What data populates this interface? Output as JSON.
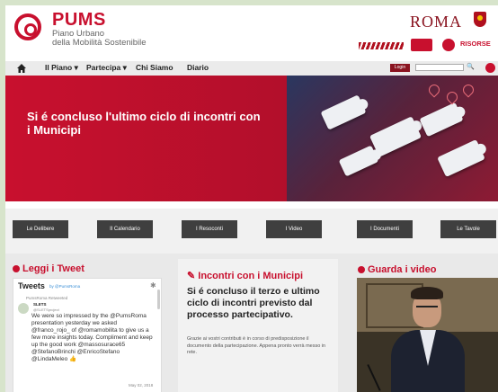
{
  "header": {
    "logo_title": "PUMS",
    "logo_line1": "Piano Urbano",
    "logo_line2": "della Mobilità Sostenibile",
    "city": "ROMA",
    "partner_text": "RISORSE"
  },
  "nav": {
    "items": [
      "Il Piano ▾",
      "Partecipa ▾",
      "Chi Siamo",
      "Diario"
    ],
    "login_label": "Login",
    "search_placeholder": ""
  },
  "hero": {
    "title": "Si é concluso l'ultimo ciclo di incontri con i Municipi"
  },
  "tiles": [
    "Le Delibere",
    "Il Calendario",
    "I Resoconti",
    "I Video",
    "I Documenti",
    "Le Tavole"
  ],
  "tweets": {
    "section_title": "Leggi i Tweet",
    "widget_title": "Tweets",
    "widget_handle": "by @PumsRoma",
    "retweet_label": "PumsRoma Retweeted",
    "author_name": "SLETS",
    "author_handle": "@SLETSproject",
    "text": "We were so impressed by the @PumsRoma presentation yesterday we asked @franco_rojo_ of @romamobilita to give us a few more insights today. Compliment and keep up the good work @massosurace65 @StefanoBrinchi @EnricoStefano @LindaMeleo 👍",
    "date": "May 02, 2018"
  },
  "municipi": {
    "title": "Incontri con i Municipi",
    "headline": "Si é concluso il terzo e ultimo ciclo di incontri previsto dal processo partecipativo.",
    "body": "Grazie ai vostri contributi è in corso di predisposizione il documento della partecipazione. Appena pronto verrà messo in rete."
  },
  "video": {
    "title": "Guarda i video"
  },
  "colors": {
    "brand": "#c8102e",
    "dark_red": "#8a1420",
    "tile": "#3f3f3f"
  }
}
